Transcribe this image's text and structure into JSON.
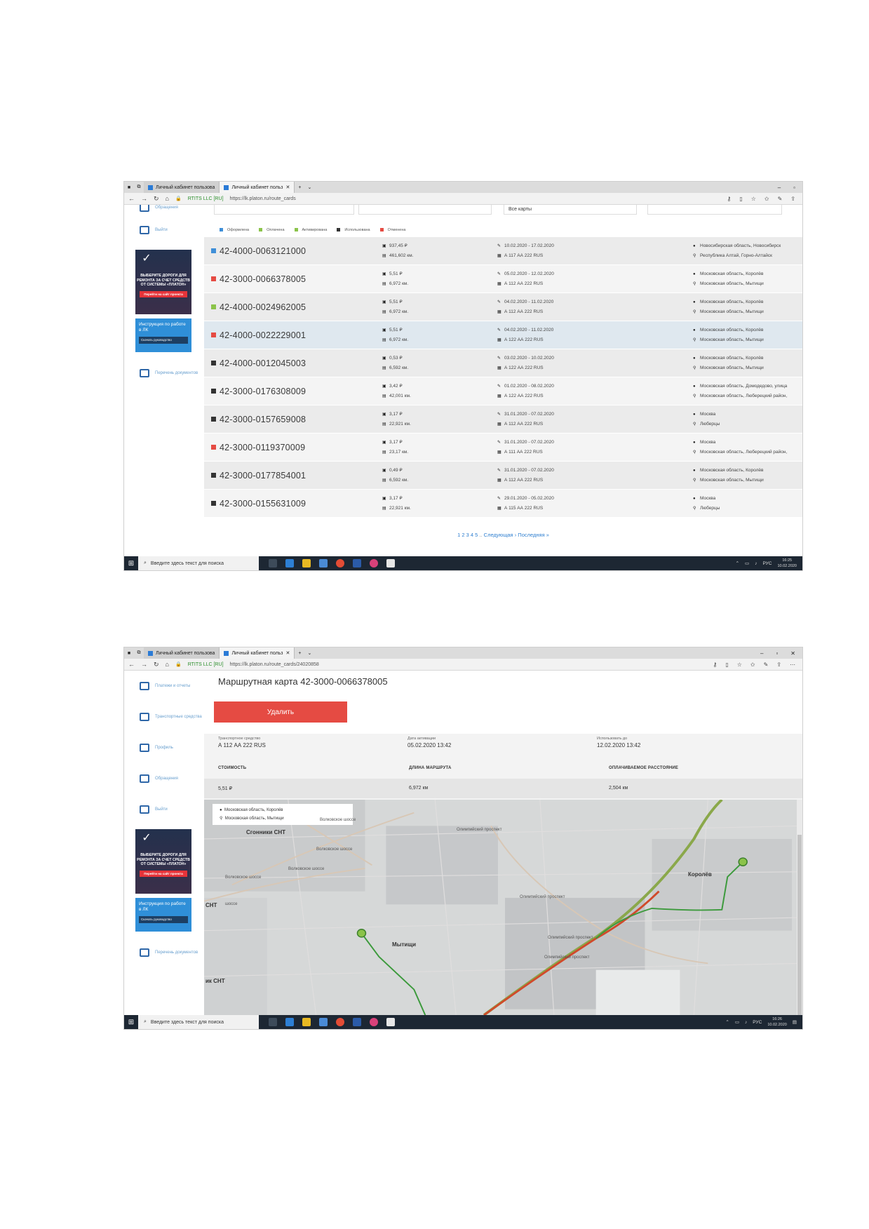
{
  "browser": {
    "tab1": "Личный кабинет пользова",
    "tab2": "Личный кабинет польз",
    "cert": "RTITS LLC [RU]",
    "url1": "https://lk.platon.ru/route_cards",
    "url2": "https://lk.platon.ru/route_cards/24020858"
  },
  "sidebar": {
    "obrashcheniya": "Обращения",
    "vyhod": "Выйти",
    "platezhi": "Платежи и отчеты",
    "transport": "Транспортные средства",
    "profil": "Профиль",
    "banner_text": "ВЫБЕРИТЕ ДОРОГИ ДЛЯ РЕМОНТА ЗА СЧЕТ СРЕДСТВ ОТ СИСТЕМЫ «ПЛАТОН»",
    "banner_btn": "Перейти на сайт проекта",
    "guide_text": "Инструкция по работе в ЛК",
    "guide_btn": "Скачать руководство",
    "docs": "Перечень документов"
  },
  "filters": {
    "cards": "Все карты"
  },
  "legend": {
    "items": [
      {
        "label": "Оформлена",
        "color": "#3f8fd8"
      },
      {
        "label": "Оплачена",
        "color": "#8bc34a"
      },
      {
        "label": "Активирована",
        "color": "#8bc34a"
      },
      {
        "label": "Использована",
        "color": "#333333"
      },
      {
        "label": "Отменена",
        "color": "#e54b43"
      }
    ]
  },
  "rows": [
    {
      "num": "42-4000-0063121000",
      "status": "#3f8fd8",
      "cost": "937,45 ₽",
      "dist": "461,602 км.",
      "dates": "10.02.2020 - 17.02.2020",
      "plate": "А 117 АА 222 RUS",
      "from": "Новосибирская область, Новосибирск",
      "to": "Республика Алтай, Горно-Алтайск"
    },
    {
      "num": "42-3000-0066378005",
      "status": "#e54b43",
      "cost": "5,51 ₽",
      "dist": "6,972 км.",
      "dates": "05.02.2020 - 12.02.2020",
      "plate": "А 112 АА 222 RUS",
      "from": "Московская область, Королёв",
      "to": "Московская область, Мытищи"
    },
    {
      "num": "42-4000-0024962005",
      "status": "#8bc34a",
      "cost": "5,51 ₽",
      "dist": "6,972 км.",
      "dates": "04.02.2020 - 11.02.2020",
      "plate": "А 112 АА 222 RUS",
      "from": "Московская область, Королёв",
      "to": "Московская область, Мытищи"
    },
    {
      "num": "42-4000-0022229001",
      "status": "#e54b43",
      "cost": "5,51 ₽",
      "dist": "6,972 км.",
      "dates": "04.02.2020 - 11.02.2020",
      "plate": "А 122 АА 222 RUS",
      "from": "Московская область, Королёв",
      "to": "Московская область, Мытищи"
    },
    {
      "num": "42-4000-0012045003",
      "status": "#333333",
      "cost": "0,53 ₽",
      "dist": "6,592 км.",
      "dates": "03.02.2020 - 10.02.2020",
      "plate": "А 122 АА 222 RUS",
      "from": "Московская область, Королёв",
      "to": "Московская область, Мытищи"
    },
    {
      "num": "42-3000-0176308009",
      "status": "#333333",
      "cost": "3,42 ₽",
      "dist": "42,001 км.",
      "dates": "01.02.2020 - 08.02.2020",
      "plate": "А 122 АА 222 RUS",
      "from": "Московская область, Домодедово, улица",
      "to": "Московская область, Люберецкий район,"
    },
    {
      "num": "42-3000-0157659008",
      "status": "#333333",
      "cost": "3,17 ₽",
      "dist": "22,921 км.",
      "dates": "31.01.2020 - 07.02.2020",
      "plate": "А 112 АА 222 RUS",
      "from": "Москва",
      "to": "Люберцы"
    },
    {
      "num": "42-3000-0119370009",
      "status": "#e54b43",
      "cost": "3,17 ₽",
      "dist": "23,17 км.",
      "dates": "31.01.2020 - 07.02.2020",
      "plate": "А 111 АА 222 RUS",
      "from": "Москва",
      "to": "Московская область, Люберецкий район,"
    },
    {
      "num": "42-3000-0177854001",
      "status": "#333333",
      "cost": "0,49 ₽",
      "dist": "6,592 км.",
      "dates": "31.01.2020 - 07.02.2020",
      "plate": "А 112 АА 222 RUS",
      "from": "Московская область, Королёв",
      "to": "Московская область, Мытищи"
    },
    {
      "num": "42-3000-0155631009",
      "status": "#333333",
      "cost": "3,17 ₽",
      "dist": "22,921 км.",
      "dates": "29.01.2020 - 05.02.2020",
      "plate": "А 115 АА 222 RUS",
      "from": "Москва",
      "to": "Люберцы"
    }
  ],
  "pager": {
    "pages": "1 2 3 4 5",
    "ellipsis": "..",
    "next": "Следующая ›",
    "last": "Последняя »"
  },
  "taskbar": {
    "search": "Введите здесь текст для поиска",
    "lang": "РУС",
    "time1": "16:25",
    "time2": "16:26",
    "date": "10.02.2020"
  },
  "detail": {
    "title": "Маршрутная карта 42-3000-0066378005",
    "delete": "Удалить",
    "vehicle_label": "Транспортное средство",
    "vehicle": "А 112 АА 222 RUS",
    "activation_label": "Дата активации",
    "activation": "05.02.2020 13:42",
    "valid_label": "Использовать до",
    "valid": "12.02.2020 13:42",
    "cost_hdr": "СТОИМОСТЬ",
    "len_hdr": "ДЛИНА МАРШРУТА",
    "paid_hdr": "ОПЛАЧИВАЕМОЕ РАССТОЯНИЕ",
    "cost": "5,51 ₽",
    "len": "6,972 км",
    "paid": "2,504 км"
  },
  "map": {
    "from": "Московская область, Королёв",
    "to": "Московская область, Мытищи",
    "labels": {
      "sgonniki": "Сгонники СНТ",
      "volk1": "Волковское шоссе",
      "volk2": "Волковское шоссе",
      "volk3": "Волковское шоссе",
      "volk4": "Волковское шоссе",
      "olymp1": "Олимпийский проспект",
      "olymp2": "Олимпийский проспект",
      "olymp3": "Олимпийский проспект",
      "olymp4": "Олимпийский проспект",
      "mytishchi": "Мытищи",
      "korolev": "Королёв",
      "snt1": "СНТ",
      "snt2": "ик СНТ",
      "shosse": "шоссе"
    }
  }
}
